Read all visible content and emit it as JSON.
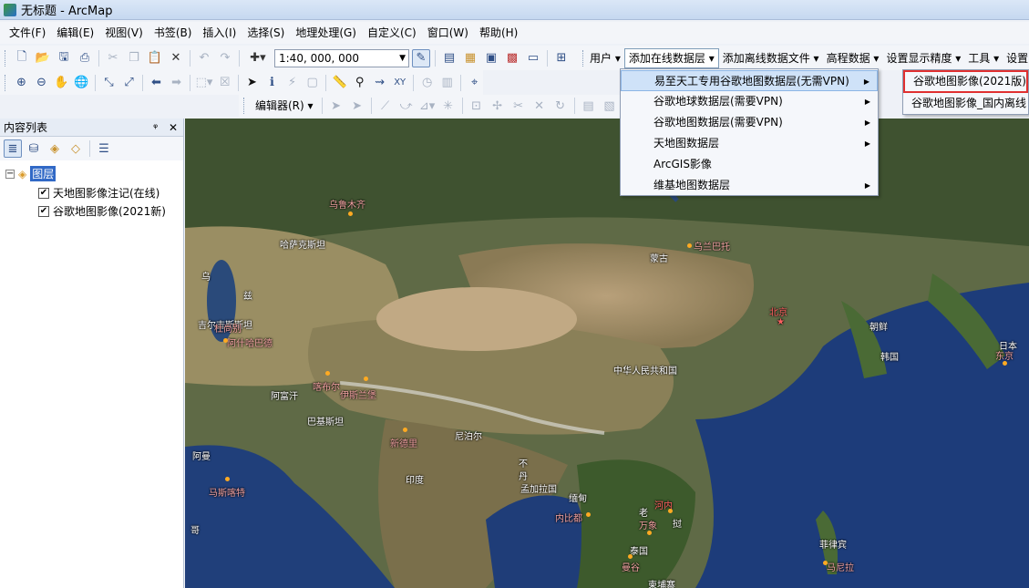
{
  "window": {
    "title": "无标题 - ArcMap"
  },
  "menubar": [
    "文件(F)",
    "编辑(E)",
    "视图(V)",
    "书签(B)",
    "插入(I)",
    "选择(S)",
    "地理处理(G)",
    "自定义(C)",
    "窗口(W)",
    "帮助(H)"
  ],
  "standard_toolbar": {
    "scale": "1:40, 000, 000"
  },
  "plugin_toolbar": {
    "items": [
      "用户",
      "添加在线数据层",
      "添加离线数据文件",
      "高程数据",
      "设置显示精度",
      "工具",
      "设置"
    ]
  },
  "editor_toolbar": {
    "label": "编辑器(R)"
  },
  "dropdown": {
    "items": [
      {
        "label": "易至天工专用谷歌地图数据层(无需VPN)",
        "has_submenu": true
      },
      {
        "label": "谷歌地球数据层(需要VPN)",
        "has_submenu": true
      },
      {
        "label": "谷歌地图数据层(需要VPN)",
        "has_submenu": true
      },
      {
        "label": "天地图数据层",
        "has_submenu": true
      },
      {
        "label": "ArcGIS影像",
        "has_submenu": false
      },
      {
        "label": "维基地图数据层",
        "has_submenu": true
      }
    ]
  },
  "submenu": {
    "items": [
      "谷歌地图影像(2021版)",
      "谷歌地图影像_国内离线"
    ]
  },
  "toc": {
    "title": "内容列表",
    "pin": "ᵠ",
    "close": "✕",
    "root": "图层",
    "layers": [
      {
        "label": "天地图影像注记(在线)",
        "checked": true
      },
      {
        "label": "谷歌地图影像(2021新)",
        "checked": true
      }
    ]
  },
  "map_labels": [
    "乌鲁木齐",
    "哈萨克斯坦",
    "蒙古",
    "乌兰巴托",
    "乌",
    "兹",
    "吉尔吉斯斯坦",
    "杜尚别",
    "阿什哈巴德",
    "北京",
    "朝鲜",
    "日本",
    "东京",
    "韩国",
    "喀布尔",
    "伊斯兰堡",
    "阿富汗",
    "巴基斯坦",
    "新德里",
    "中华人民共和国",
    "尼泊尔",
    "不",
    "丹",
    "印度",
    "孟加拉国",
    "阿曼",
    "马斯喀特",
    "缅甸",
    "内比都",
    "河内",
    "老",
    "万象",
    "挝",
    "泰国",
    "曼谷",
    "柬埔寨",
    "菲律宾",
    "马尼拉",
    "哥"
  ]
}
